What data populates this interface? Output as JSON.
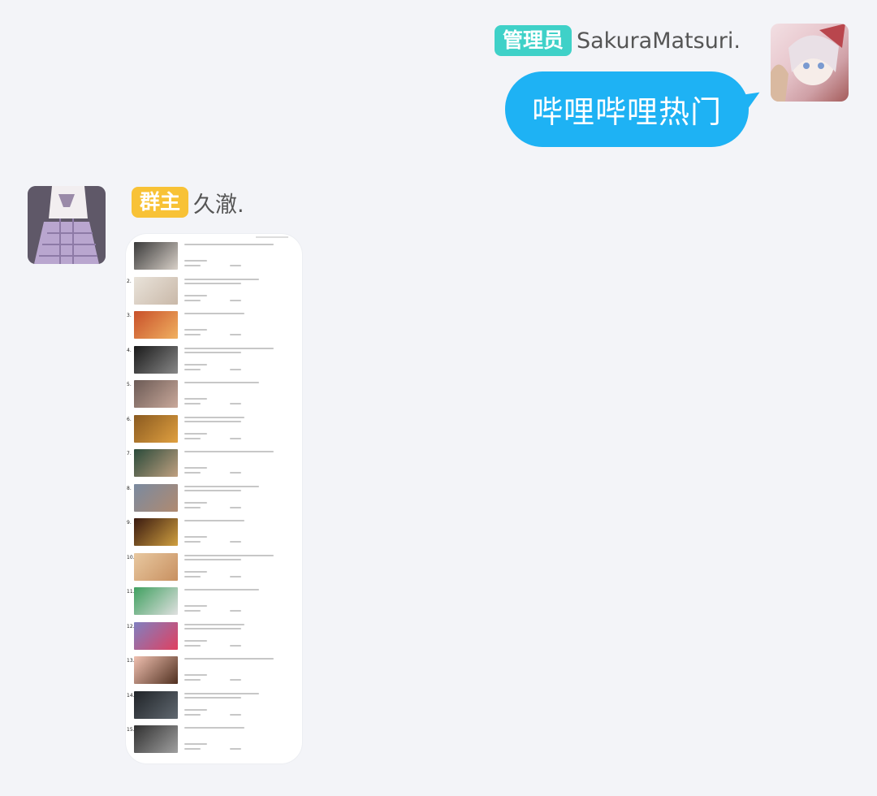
{
  "messages": [
    {
      "side": "right",
      "badge": "管理员",
      "badge_color": "#3fd1c8",
      "sender": "SakuraMatsuri.",
      "text": "哔哩哔哩热门",
      "bubble_color": "#1eb2f4"
    },
    {
      "side": "left",
      "badge": "群主",
      "badge_color": "#f8c236",
      "sender": "久澈.",
      "attachment": {
        "type": "screenshot-image",
        "rows": [
          {
            "num": "",
            "thumb": [
              "#3a3a3a",
              "#d8d0c8"
            ]
          },
          {
            "num": "2.",
            "thumb": [
              "#e9e3da",
              "#c9b8a8"
            ]
          },
          {
            "num": "3.",
            "thumb": [
              "#c8502a",
              "#f0b060"
            ]
          },
          {
            "num": "4.",
            "thumb": [
              "#1a1a1a",
              "#888888"
            ]
          },
          {
            "num": "5.",
            "thumb": [
              "#6b5a55",
              "#c9a89a"
            ]
          },
          {
            "num": "6.",
            "thumb": [
              "#8a5a20",
              "#e0a040"
            ]
          },
          {
            "num": "7.",
            "thumb": [
              "#2a4a3a",
              "#c0a080"
            ]
          },
          {
            "num": "8.",
            "thumb": [
              "#7a8aa0",
              "#b08a70"
            ]
          },
          {
            "num": "9.",
            "thumb": [
              "#3a1a10",
              "#d0a040"
            ]
          },
          {
            "num": "10.",
            "thumb": [
              "#e8c8a0",
              "#c89060"
            ]
          },
          {
            "num": "11.",
            "thumb": [
              "#40a060",
              "#e0e0e0"
            ]
          },
          {
            "num": "12.",
            "thumb": [
              "#8080c0",
              "#e04060"
            ]
          },
          {
            "num": "13.",
            "thumb": [
              "#f0c0b0",
              "#503020"
            ]
          },
          {
            "num": "14.",
            "thumb": [
              "#202428",
              "#606870"
            ]
          },
          {
            "num": "15.",
            "thumb": [
              "#303030",
              "#a0a0a0"
            ]
          }
        ]
      }
    }
  ]
}
